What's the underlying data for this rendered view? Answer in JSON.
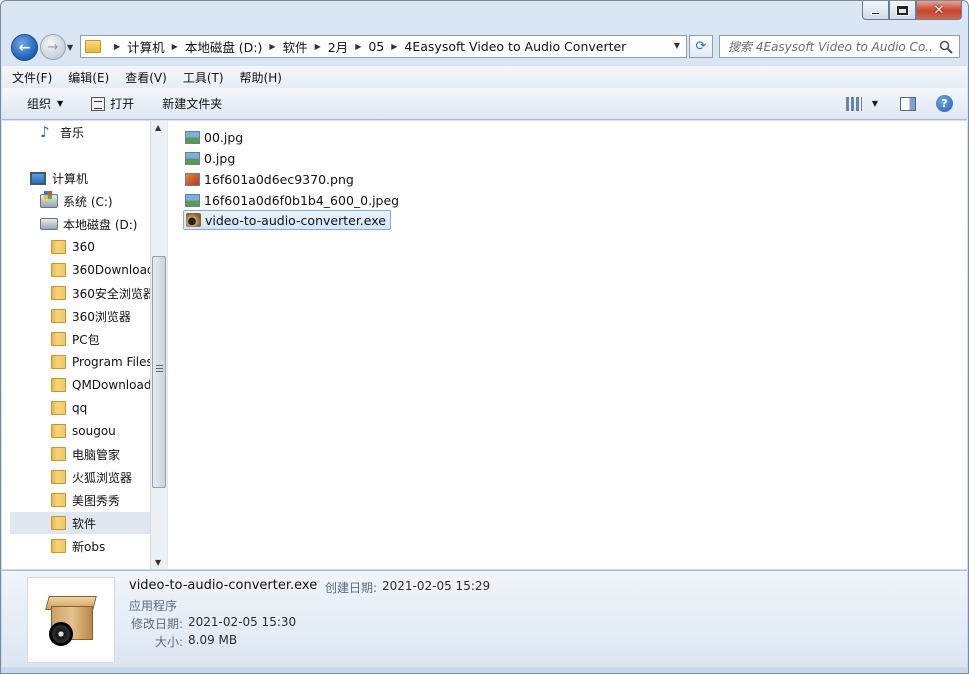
{
  "window": {
    "minimize_label": "",
    "maximize_label": "",
    "close_label": "✕"
  },
  "address": {
    "crumbs": [
      "计算机",
      "本地磁盘 (D:)",
      "软件",
      "2月",
      "05",
      "4Easysoft Video to Audio Converter"
    ]
  },
  "search": {
    "placeholder": "搜索 4Easysoft Video to Audio Co..."
  },
  "menu": [
    "文件(F)",
    "编辑(E)",
    "查看(V)",
    "工具(T)",
    "帮助(H)"
  ],
  "toolbar": {
    "organize": "组织",
    "open": "打开",
    "new_folder": "新建文件夹"
  },
  "nav": {
    "music": "音乐",
    "computer": "计算机",
    "system_drive": "系统 (C:)",
    "local_drive": "本地磁盘 (D:)",
    "folders": [
      "360",
      "360Download",
      "360安全浏览器",
      "360浏览器",
      "PC包",
      "Program Files",
      "QMDownload",
      "qq",
      "sougou",
      "电脑管家",
      "火狐浏览器",
      "美图秀秀",
      "软件",
      "新obs"
    ],
    "selected_folder": "软件"
  },
  "files": [
    {
      "name": "00.jpg",
      "icon": "jpg-icon"
    },
    {
      "name": "0.jpg",
      "icon": "jpg-icon"
    },
    {
      "name": "16f601a0d6ec9370.png",
      "icon": "png-icon"
    },
    {
      "name": "16f601a0d6f0b1b4_600_0.jpeg",
      "icon": "jpeg-icon"
    },
    {
      "name": "video-to-audio-converter.exe",
      "icon": "exe-icon",
      "selected": true
    }
  ],
  "details": {
    "name": "video-to-audio-converter.exe",
    "created_label": "创建日期:",
    "created_value": "2021-02-05 15:29",
    "type": "应用程序",
    "modified_label": "修改日期:",
    "modified_value": "2021-02-05 15:30",
    "size_label": "大小:",
    "size_value": "8.09 MB"
  }
}
